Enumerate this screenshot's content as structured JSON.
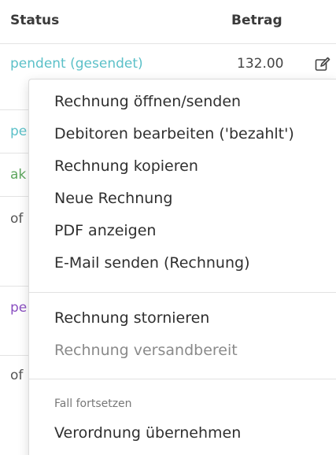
{
  "table": {
    "headers": {
      "status": "Status",
      "betrag": "Betrag"
    },
    "rows": [
      {
        "status": "pendent (gesendet)",
        "amount": "132.00",
        "status_color": "#5bc0c8"
      },
      {
        "status": "pe",
        "status_color": "#5bc0c8"
      },
      {
        "status": "ak",
        "status_color": "#5ca55c"
      },
      {
        "status": "of",
        "status_color": "#555555"
      },
      {
        "status": "pe",
        "status_color": "#8a4fc1"
      },
      {
        "status": "of",
        "status_color": "#555555"
      }
    ],
    "edit_icon": "edit-icon"
  },
  "menu": {
    "items": [
      {
        "label": "Rechnung öffnen/senden"
      },
      {
        "label": "Debitoren bearbeiten ('bezahlt')"
      },
      {
        "label": "Rechnung kopieren"
      },
      {
        "label": "Neue Rechnung"
      },
      {
        "label": "PDF anzeigen"
      },
      {
        "label": "E-Mail senden (Rechnung)"
      },
      {
        "label": "Rechnung stornieren"
      },
      {
        "label": "Rechnung versandbereit",
        "disabled": true
      }
    ],
    "section_header": "Fall fortsetzen",
    "section_items": [
      {
        "label": "Verordnung übernehmen"
      }
    ]
  }
}
